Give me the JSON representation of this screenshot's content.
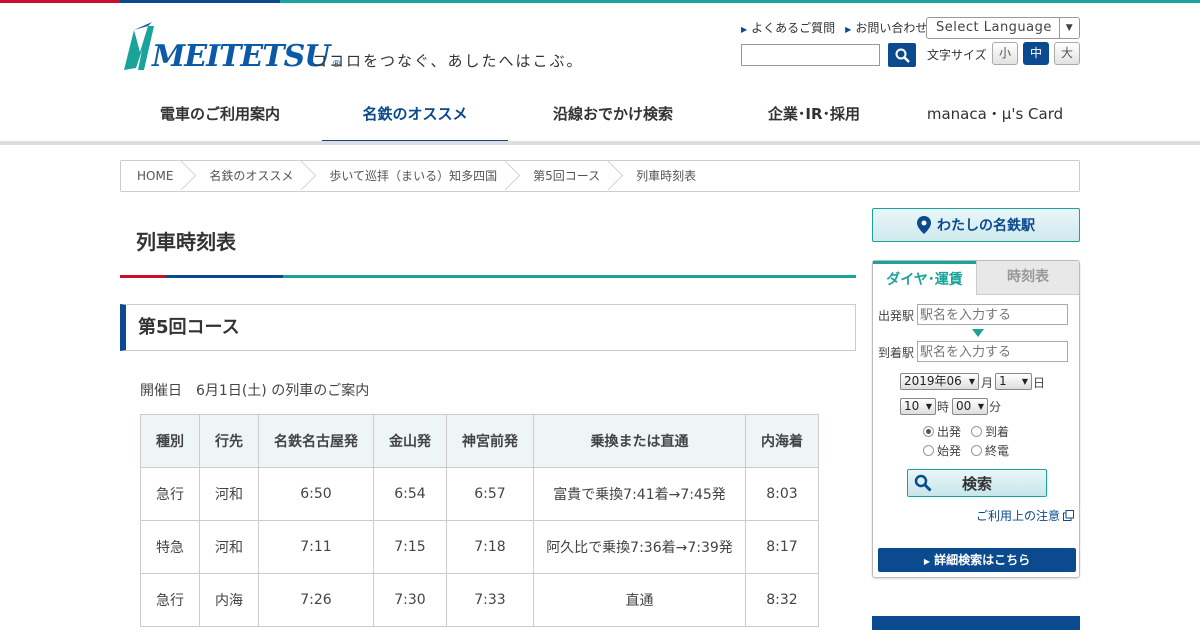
{
  "header": {
    "logo_text": "MEITETSU",
    "logo_reg": "®",
    "tagline": "ココロをつなぐ、あしたへはこぶ。",
    "util_links": [
      "よくあるご質問",
      "お問い合わせ"
    ],
    "language_select": "Select Language",
    "search_placeholder": "",
    "fontsize_label": "文字サイズ",
    "fontsize_options": [
      "小",
      "中",
      "大"
    ]
  },
  "gnav": [
    "電車のご利用案内",
    "名鉄のオススメ",
    "沿線おでかけ検索",
    "企業･IR･採用",
    "manaca・μ's Card"
  ],
  "breadcrumb": [
    "HOME",
    "名鉄のオススメ",
    "歩いて巡拝（まいる）知多四国",
    "第5回コース",
    "列車時刻表"
  ],
  "main": {
    "title": "列車時刻表",
    "section": "第5回コース",
    "event_date": "開催日　6月1日(土) の列車のご案内"
  },
  "timetable": {
    "headers": [
      "種別",
      "行先",
      "名鉄名古屋発",
      "金山発",
      "神宮前発",
      "乗換または直通",
      "内海着"
    ],
    "rows": [
      [
        "急行",
        "河和",
        "6:50",
        "6:54",
        "6:57",
        "富貴で乗換7:41着→7:45発",
        "8:03"
      ],
      [
        "特急",
        "河和",
        "7:11",
        "7:15",
        "7:18",
        "阿久比で乗換7:36着→7:39発",
        "8:17"
      ],
      [
        "急行",
        "内海",
        "7:26",
        "7:30",
        "7:33",
        "直通",
        "8:32"
      ]
    ]
  },
  "sidebar": {
    "mymeitetsu": "わたしの名鉄駅",
    "tabs": [
      "ダイヤ･運賃",
      "時刻表"
    ],
    "from_label": "出発駅",
    "to_label": "到着駅",
    "station_placeholder": "駅名を入力する",
    "year_month": "2019年06",
    "month_unit": "月",
    "day": "1",
    "day_unit": "日",
    "hour": "10",
    "hour_unit": "時",
    "minute": "00",
    "minute_unit": "分",
    "radios": [
      "出発",
      "到着",
      "始発",
      "終電"
    ],
    "search_button": "検索",
    "note_link": "ご利用上の注意",
    "detail_button": "詳細検索はこちら"
  },
  "colors": {
    "brand_blue": "#0b4a8f",
    "brand_teal": "#1aa39a",
    "brand_red": "#c8102e"
  }
}
